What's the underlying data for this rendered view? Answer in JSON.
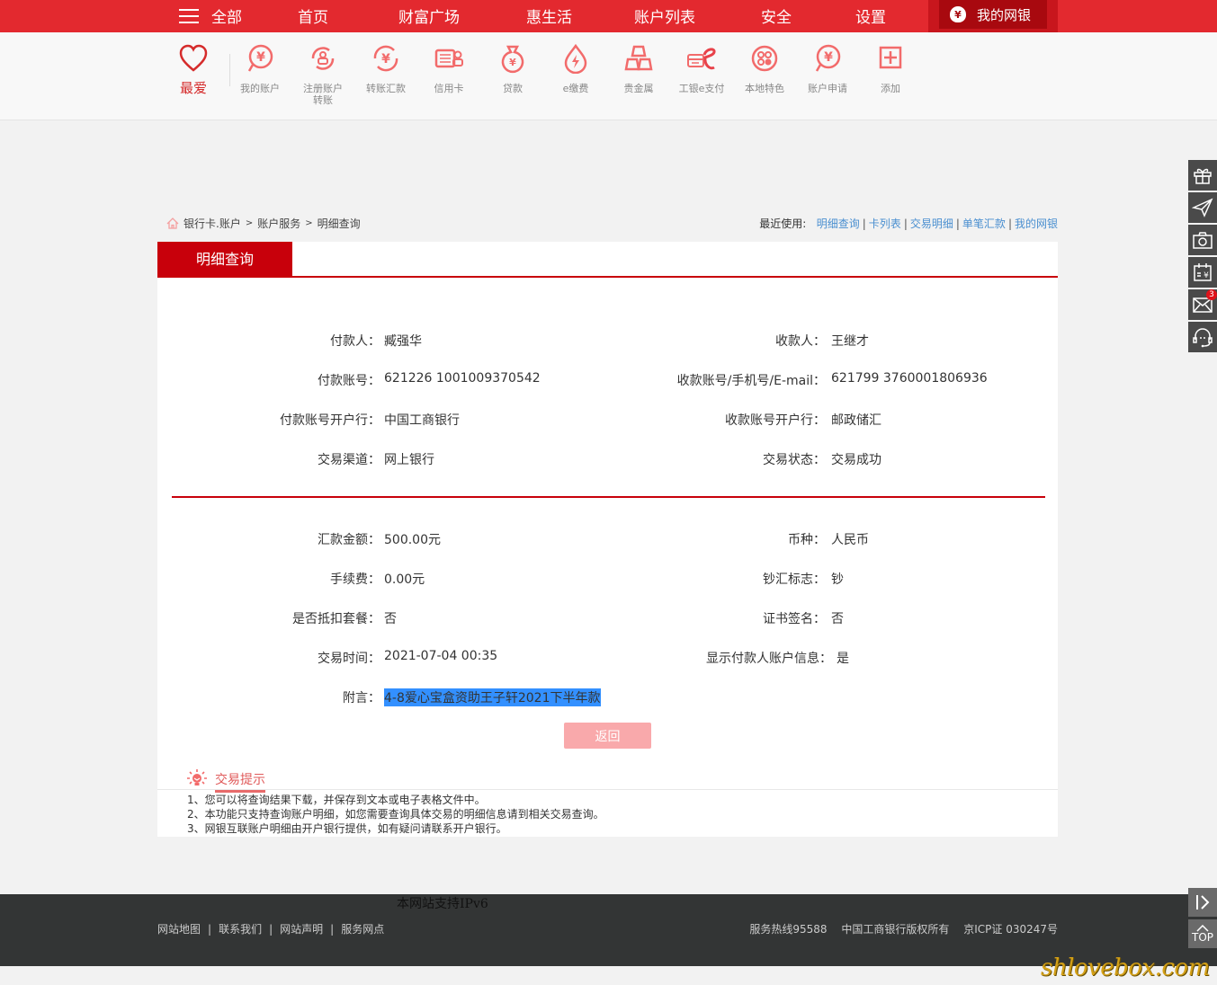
{
  "topnav": {
    "menu_label": "全部",
    "items": [
      "首页",
      "财富广场",
      "惠生活",
      "账户列表",
      "安全",
      "设置"
    ],
    "mybank": "我的网银"
  },
  "shortcuts": {
    "favorite": "最爱",
    "items": [
      {
        "label": "我的账户",
        "icon": "yen-bubble-icon"
      },
      {
        "label": "注册账户转账",
        "icon": "account-transfer-icon"
      },
      {
        "label": "转账汇款",
        "icon": "transfer-icon"
      },
      {
        "label": "信用卡",
        "icon": "credit-card-icon"
      },
      {
        "label": "贷款",
        "icon": "money-bag-icon"
      },
      {
        "label": "e缴费",
        "icon": "drop-bolt-icon"
      },
      {
        "label": "贵金属",
        "icon": "gold-bars-icon"
      },
      {
        "label": "工银e支付",
        "icon": "epay-icon"
      },
      {
        "label": "本地特色",
        "icon": "local-icon"
      },
      {
        "label": "账户申请",
        "icon": "yen-bubble-icon"
      },
      {
        "label": "添加",
        "icon": "plus-icon"
      }
    ]
  },
  "breadcrumb": [
    "银行卡.账户",
    "账户服务",
    "明细查询"
  ],
  "recent": {
    "label": "最近使用:",
    "links": [
      "明细查询",
      "卡列表",
      "交易明细",
      "单笔汇款",
      "我的网银"
    ]
  },
  "panel": {
    "tab": "明细查询",
    "section1": {
      "left": [
        {
          "k": "付款人：",
          "v": "臧强华"
        },
        {
          "k": "付款账号：",
          "v": "621226 1001009370542"
        },
        {
          "k": "付款账号开户行：",
          "v": "中国工商银行"
        },
        {
          "k": "交易渠道：",
          "v": "网上银行"
        }
      ],
      "right": [
        {
          "k": "收款人：",
          "v": "王继才"
        },
        {
          "k": "收款账号/手机号/E-mail：",
          "v": "621799 3760001806936"
        },
        {
          "k": "收款账号开户行：",
          "v": "邮政储汇"
        },
        {
          "k": "交易状态：",
          "v": "交易成功"
        }
      ]
    },
    "section2": {
      "left": [
        {
          "k": "汇款金额：",
          "v": "500.00元"
        },
        {
          "k": "手续费：",
          "v": "0.00元"
        },
        {
          "k": "是否抵扣套餐：",
          "v": "否"
        },
        {
          "k": "交易时间：",
          "v": "2021-07-04 00:35"
        },
        {
          "k": "附言：",
          "v": "4-8爱心宝盒资助王子轩2021下半年款"
        }
      ],
      "right": [
        {
          "k": "币种：",
          "v": "人民币"
        },
        {
          "k": "钞汇标志：",
          "v": "钞"
        },
        {
          "k": "证书签名：",
          "v": "否"
        },
        {
          "k": "显示付款人账户信息：",
          "v": "是"
        }
      ]
    },
    "back_button": "返回"
  },
  "tips": {
    "title": "交易提示",
    "items": [
      "1、您可以将查询结果下载，并保存到文本或电子表格文件中。",
      "2、本功能只支持查询账户明细，如您需要查询具体交易的明细信息请到相关交易查询。",
      "3、网银互联账户明细由开户银行提供，如有疑问请联系开户银行。"
    ]
  },
  "footer": {
    "ipv6": "本网站支持IPv6",
    "links": [
      "网站地图",
      "联系我们",
      "网站声明",
      "服务网点"
    ],
    "hotline": "服务热线95588",
    "copyright": "中国工商银行版权所有",
    "icp": "京ICP证 030247号"
  },
  "side_tools": {
    "mail_badge": "3",
    "top_label": "TOP"
  },
  "watermark": "shlovebox.com",
  "colors": {
    "brand_red": "#e3292f",
    "tab_red": "#c8000b",
    "icon_pink": "#f26b6b",
    "link_blue": "#4a8fd0",
    "selection_blue": "#3390ff"
  }
}
